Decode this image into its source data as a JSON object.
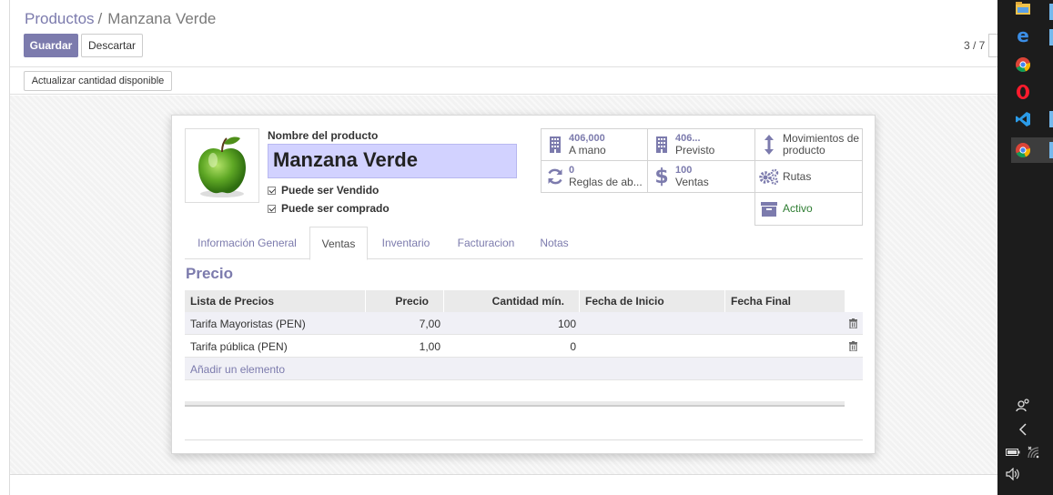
{
  "breadcrumb": {
    "parent": "Productos",
    "separator": "/",
    "current": "Manzana Verde"
  },
  "buttons": {
    "save": "Guardar",
    "discard": "Descartar",
    "update_qty": "Actualizar cantidad disponible"
  },
  "pager": {
    "value": "3 / 7"
  },
  "product": {
    "name_label": "Nombre del producto",
    "name": "Manzana Verde",
    "can_be_sold": "Puede ser Vendido",
    "can_be_purchased": "Puede ser comprado"
  },
  "smart_buttons": {
    "on_hand": {
      "value": "406,000",
      "label": "A mano"
    },
    "forecast": {
      "value": "406...",
      "label": "Previsto"
    },
    "moves": {
      "label": "Movimientos de producto"
    },
    "reorder": {
      "value": "0",
      "label": "Reglas de ab..."
    },
    "sales": {
      "value": "100",
      "label": "Ventas"
    },
    "routes": {
      "label": "Rutas"
    },
    "active": {
      "label": "Activo"
    }
  },
  "tabs": [
    "Información General",
    "Ventas",
    "Inventario",
    "Facturacion",
    "Notas"
  ],
  "active_tab": "Ventas",
  "section_title": "Precio",
  "table": {
    "headers": [
      "Lista de Precios",
      "Precio",
      "Cantidad mín.",
      "Fecha de Inicio",
      "Fecha Final"
    ],
    "rows": [
      [
        "Tarifa Mayoristas (PEN)",
        "7,00",
        "100",
        "",
        ""
      ],
      [
        "Tarifa pública (PEN)",
        "1,00",
        "0",
        "",
        ""
      ]
    ],
    "add_item": "Añadir un elemento"
  },
  "colors": {
    "accent": "#7c7bad",
    "name_field_bg": "#d2d2ff",
    "active_green": "#2e7d32",
    "taskbar": "#1c1c1c"
  },
  "taskbar_icons": [
    "file-explorer-icon",
    "edge-icon",
    "chrome-icon",
    "opera-icon",
    "vscode-icon",
    "chrome-icon",
    "people-icon",
    "chevron-left-icon",
    "battery-icon",
    "wifi-icon",
    "volume-icon"
  ]
}
